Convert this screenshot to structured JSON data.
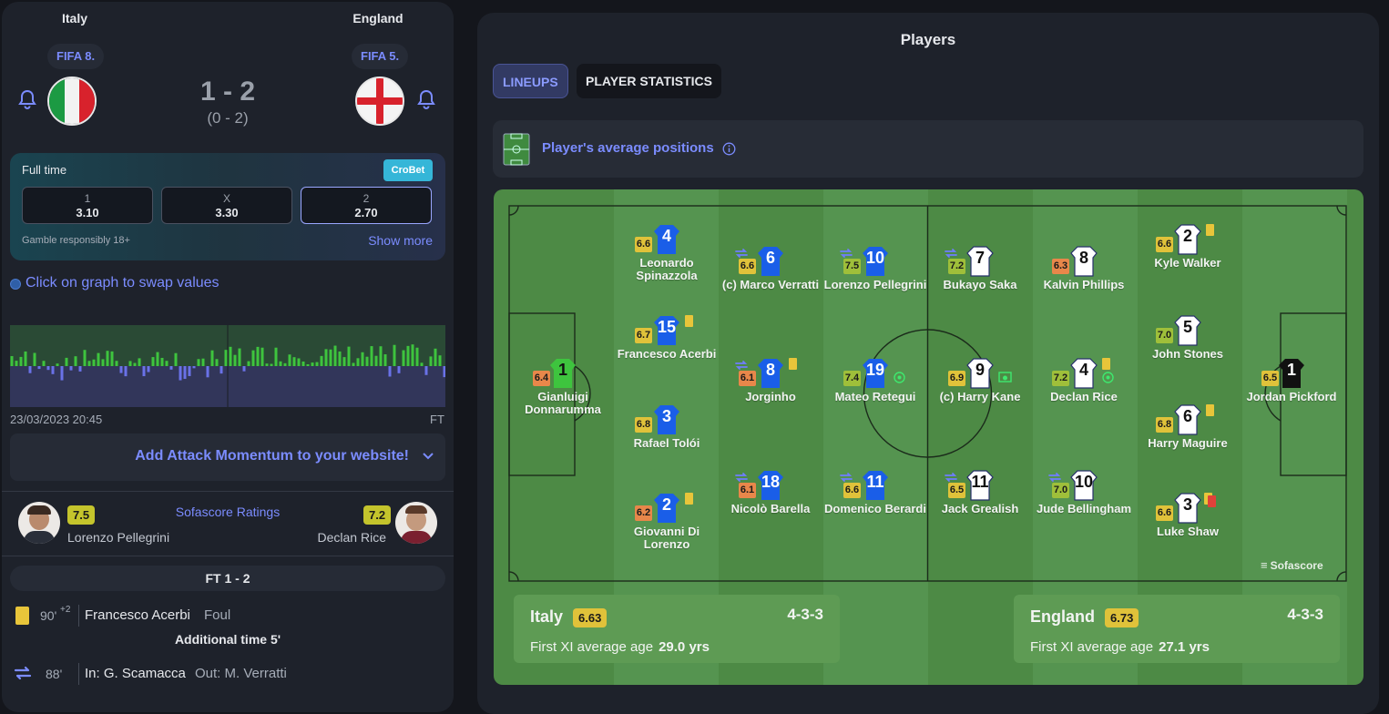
{
  "match": {
    "home": {
      "name": "Italy",
      "rank": "FIFA 8."
    },
    "away": {
      "name": "England",
      "rank": "FIFA 5."
    },
    "score": "1 - 2",
    "halftime": "(0 - 2)"
  },
  "odds": {
    "status": "Full time",
    "bookmaker": "CroBet",
    "options": [
      {
        "label": "1",
        "value": "3.10"
      },
      {
        "label": "X",
        "value": "3.30"
      },
      {
        "label": "2",
        "value": "2.70"
      }
    ],
    "disclaimer": "Gamble responsibly 18+",
    "show_more": "Show more"
  },
  "momentum": {
    "hint": "Click on graph to swap values",
    "date": "23/03/2023 20:45",
    "end_label": "FT",
    "add_link": "Add Attack Momentum to your website!"
  },
  "ratings": {
    "title": "Sofascore Ratings",
    "home_player": "Lorenzo Pellegrini",
    "home_rating": "7.5",
    "away_player": "Declan Rice",
    "away_rating": "7.2"
  },
  "events": {
    "ft_label": "FT 1 - 2",
    "card": {
      "minute": "90'",
      "added": "+2",
      "player": "Francesco Acerbi",
      "reason": "Foul"
    },
    "additional": "Additional time 5'",
    "sub": {
      "minute": "88'",
      "in_label": "In: G. Scamacca",
      "out_label": "Out: M. Verratti"
    }
  },
  "players_panel": {
    "title": "Players",
    "tab_lineups": "LINEUPS",
    "tab_stats": "PLAYER STATISTICS",
    "avg_positions": "Player's average positions",
    "watermark": "Sofascore"
  },
  "home_team": {
    "name": "Italy",
    "rating": "6.63",
    "formation": "4-3-3",
    "age_label": "First XI average age",
    "age_value": "29.0 yrs",
    "players": [
      {
        "num": "1",
        "name": "Gianluigi Donnarumma",
        "rating": "6.4"
      },
      {
        "num": "4",
        "name": "Leonardo Spinazzola",
        "rating": "6.6"
      },
      {
        "num": "15",
        "name": "Francesco Acerbi",
        "rating": "6.7"
      },
      {
        "num": "3",
        "name": "Rafael Tolói",
        "rating": "6.8"
      },
      {
        "num": "2",
        "name": "Giovanni Di Lorenzo",
        "rating": "6.2"
      },
      {
        "num": "6",
        "name": "(c) Marco Verratti",
        "rating": "6.6"
      },
      {
        "num": "8",
        "name": "Jorginho",
        "rating": "6.1"
      },
      {
        "num": "18",
        "name": "Nicolò Barella",
        "rating": "6.1"
      },
      {
        "num": "10",
        "name": "Lorenzo Pellegrini",
        "rating": "7.5"
      },
      {
        "num": "19",
        "name": "Mateo Retegui",
        "rating": "7.4"
      },
      {
        "num": "11",
        "name": "Domenico Berardi",
        "rating": "6.6"
      }
    ]
  },
  "away_team": {
    "name": "England",
    "rating": "6.73",
    "formation": "4-3-3",
    "age_label": "First XI average age",
    "age_value": "27.1 yrs",
    "players": [
      {
        "num": "7",
        "name": "Bukayo Saka",
        "rating": "7.2"
      },
      {
        "num": "9",
        "name": "(c) Harry Kane",
        "rating": "6.9"
      },
      {
        "num": "11",
        "name": "Jack Grealish",
        "rating": "6.5"
      },
      {
        "num": "8",
        "name": "Kalvin Phillips",
        "rating": "6.3"
      },
      {
        "num": "4",
        "name": "Declan Rice",
        "rating": "7.2"
      },
      {
        "num": "10",
        "name": "Jude Bellingham",
        "rating": "7.0"
      },
      {
        "num": "2",
        "name": "Kyle Walker",
        "rating": "6.6"
      },
      {
        "num": "5",
        "name": "John Stones",
        "rating": "7.0"
      },
      {
        "num": "6",
        "name": "Harry Maguire",
        "rating": "6.8"
      },
      {
        "num": "3",
        "name": "Luke Shaw",
        "rating": "6.6"
      },
      {
        "num": "1",
        "name": "Jordan Pickford",
        "rating": "6.5"
      }
    ]
  },
  "colors": {
    "accent": "#7b8cff",
    "italy_shirt": "#1a5ee8",
    "england_shirt": "#ffffff",
    "gk_italy": "#3ec43e",
    "gk_england": "#111111"
  }
}
